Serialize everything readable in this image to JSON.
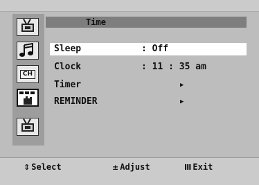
{
  "menu": {
    "title": "Time",
    "items": [
      {
        "label": "Sleep",
        "value": ": Off",
        "selected": true,
        "has_submenu": false
      },
      {
        "label": "Clock",
        "value": ": 11 : 35 am",
        "selected": false,
        "has_submenu": false
      },
      {
        "label": "Timer",
        "value": "",
        "selected": false,
        "has_submenu": true
      },
      {
        "label": "REMINDER",
        "value": "",
        "selected": false,
        "has_submenu": true
      }
    ]
  },
  "sidebar": {
    "icons": [
      "tv-picture-icon",
      "music-note-icon",
      "channel-icon",
      "setup-hand-icon",
      "tv-input-icon"
    ],
    "selected": "setup-hand-icon"
  },
  "footer": {
    "select": {
      "symbol": "⇕",
      "label": "Select"
    },
    "adjust": {
      "symbol": "±",
      "label": "Adjust"
    },
    "exit": {
      "symbol": "Ⅲ",
      "label": "Exit"
    }
  },
  "arrow_glyph": "▶"
}
